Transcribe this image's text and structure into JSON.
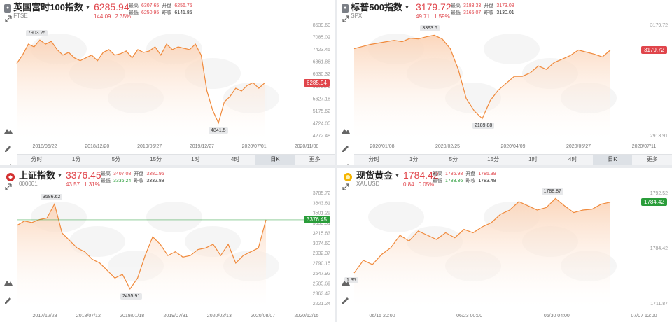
{
  "colors": {
    "red": "#e0454b",
    "green": "#2a9d3a",
    "line": "#f08a3c",
    "fill": "#fbd4b8"
  },
  "panels": [
    {
      "badge": "#",
      "name": "英国富时100指数",
      "code": "FTSE",
      "price": "6285.94",
      "change": "144.09",
      "change_pct": "2.35%",
      "stat_labels": [
        "最高",
        "开盘",
        "最低",
        "昨收"
      ],
      "stat_values": [
        "6307.65",
        "6256.75",
        "6250.95",
        "6141.85"
      ],
      "ylabels": [
        "8539.60",
        "7085.02",
        "7423.45",
        "6861.88",
        "6530.32",
        "6078.75",
        "5627.18",
        "5175.62",
        "4724.05",
        "4272.48"
      ],
      "xlabels": [
        "2018/06/22",
        "2018/12/20",
        "2019/06/27",
        "2019/12/27",
        "2020/07/01",
        "2020/11/08"
      ],
      "callout_high": "7903.25",
      "callout_low": "4841.5",
      "current_tag": "6285.94",
      "timeframes": [
        "分时",
        "1分",
        "5分",
        "15分",
        "1时",
        "4时",
        "日K",
        "更多"
      ],
      "active_tf": "日K",
      "chart_data": {
        "type": "area",
        "ylim": [
          4272.48,
          8539.6
        ],
        "values": [
          7000,
          7300,
          7700,
          7600,
          7850,
          7700,
          7800,
          7500,
          7300,
          7400,
          7200,
          7100,
          7200,
          7300,
          7100,
          7400,
          7500,
          7300,
          7350,
          7450,
          7200,
          7500,
          7400,
          7450,
          7600,
          7300,
          7700,
          7500,
          7600,
          7550,
          7500,
          7700,
          7300,
          6000,
          5300,
          4841.5,
          5600,
          5800,
          6100,
          6000,
          6200,
          6300,
          6100,
          6285.94
        ]
      }
    },
    {
      "badge": "#",
      "name": "标普500指数",
      "code": "SPX",
      "price": "3179.72",
      "change": "49.71",
      "change_pct": "1.59%",
      "stat_labels": [
        "最高",
        "开盘",
        "最低",
        "昨收"
      ],
      "stat_values": [
        "3183.33",
        "3173.08",
        "3165.07",
        "3130.01"
      ],
      "ylabels": [
        "3179.72",
        "2913.91"
      ],
      "xlabels": [
        "2020/01/08",
        "2020/02/25",
        "2020/04/09",
        "2020/05/27",
        "2020/07/11"
      ],
      "callout_high": "3393.6",
      "callout_low": "2189.88",
      "current_tag": "3179.72",
      "timeframes": [
        "分时",
        "1分",
        "5分",
        "15分",
        "1时",
        "4时",
        "日K",
        "更多"
      ],
      "active_tf": "日K",
      "chart_data": {
        "type": "area",
        "ylim": [
          1900,
          3600
        ],
        "values": [
          3200,
          3230,
          3260,
          3280,
          3300,
          3320,
          3300,
          3350,
          3340,
          3370,
          3393.6,
          3340,
          3200,
          2900,
          2480,
          2300,
          2189.88,
          2450,
          2600,
          2700,
          2800,
          2800,
          2850,
          2950,
          2900,
          3000,
          3050,
          3100,
          3180,
          3150,
          3120,
          3080,
          3179.72
        ]
      }
    },
    {
      "badge": "",
      "name": "上证指数",
      "code": "000001",
      "price": "3376.45",
      "change": "43.57",
      "change_pct": "1.31%",
      "stat_labels": [
        "最高",
        "开盘",
        "最低",
        "昨收"
      ],
      "stat_values": [
        "3407.08",
        "3380.95",
        "3336.24",
        "3332.88"
      ],
      "ylabels": [
        "3785.72",
        "3643.61",
        "3501.29",
        "3359.51",
        "3215.63",
        "3074.60",
        "2932.37",
        "2790.15",
        "2647.92",
        "2505.69",
        "2363.47",
        "2221.24"
      ],
      "xlabels": [
        "2017/12/28",
        "2018/07/12",
        "2019/01/18",
        "2019/07/31",
        "2020/02/13",
        "2020/08/07",
        "2020/12/15"
      ],
      "callout_high": "3586.62",
      "callout_low": "2455.91",
      "current_tag": "3376.45",
      "timeframes": [],
      "active_tf": "",
      "chart_data": {
        "type": "area",
        "ylim": [
          2221.24,
          3785.72
        ],
        "values": [
          3300,
          3360,
          3340,
          3380,
          3400,
          3586.62,
          3200,
          3100,
          3000,
          2950,
          2850,
          2800,
          2700,
          2600,
          2650,
          2455.91,
          2600,
          2900,
          3150,
          3050,
          2900,
          2950,
          2880,
          2900,
          2980,
          3000,
          3050,
          2900,
          3050,
          2800,
          2900,
          2950,
          3000,
          3376.45
        ]
      }
    },
    {
      "badge": "gold",
      "name": "现货黄金",
      "code": "XAUUSD",
      "price": "1784.42",
      "change": "0.84",
      "change_pct": "0.05%",
      "stat_labels": [
        "最高",
        "开盘",
        "最低",
        "昨收"
      ],
      "stat_values": [
        "1786.98",
        "1785.39",
        "1783.36",
        "1783.48"
      ],
      "ylabels": [
        "1792.52",
        "1784.42",
        "1711.87"
      ],
      "xlabels": [
        "06/15 20:00",
        "06/23 00:00",
        "06/30 04:00",
        "07/07 12:00"
      ],
      "callout_high": "1788.87",
      "callout_low": "1.35",
      "current_tag": "1784.42",
      "timeframes": [],
      "active_tf": "",
      "chart_data": {
        "type": "area",
        "ylim": [
          1660,
          1800
        ],
        "values": [
          1700,
          1715,
          1710,
          1722,
          1730,
          1745,
          1738,
          1750,
          1745,
          1740,
          1748,
          1742,
          1752,
          1748,
          1755,
          1760,
          1770,
          1775,
          1785,
          1780,
          1775,
          1778,
          1788.87,
          1780,
          1772,
          1775,
          1776,
          1782,
          1784.42
        ]
      }
    }
  ]
}
